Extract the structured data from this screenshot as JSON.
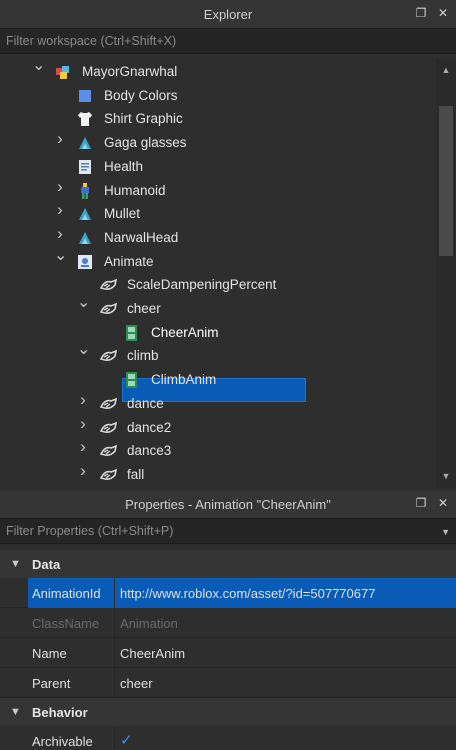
{
  "explorer": {
    "title": "Explorer",
    "filter_placeholder": "Filter workspace (Ctrl+Shift+X)",
    "items": [
      {
        "label": "MayorGnarwhal",
        "icon": "model-icon",
        "expander": "expanded",
        "indent": 0
      },
      {
        "label": "Body Colors",
        "icon": "body-colors-icon",
        "expander": "none",
        "indent": 1
      },
      {
        "label": "Shirt Graphic",
        "icon": "shirt-icon",
        "expander": "none",
        "indent": 1
      },
      {
        "label": "Gaga glasses",
        "icon": "accessory-icon",
        "expander": "collapsed",
        "indent": 1
      },
      {
        "label": "Health",
        "icon": "script-icon",
        "expander": "none",
        "indent": 1
      },
      {
        "label": "Humanoid",
        "icon": "humanoid-icon",
        "expander": "collapsed",
        "indent": 1
      },
      {
        "label": "Mullet",
        "icon": "accessory-icon",
        "expander": "collapsed",
        "indent": 1
      },
      {
        "label": "NarwalHead",
        "icon": "accessory-icon",
        "expander": "collapsed",
        "indent": 1
      },
      {
        "label": "Animate",
        "icon": "local-script-icon",
        "expander": "expanded",
        "indent": 1
      },
      {
        "label": "ScaleDampeningPercent",
        "icon": "value-icon",
        "expander": "none",
        "indent": 2
      },
      {
        "label": "cheer",
        "icon": "value-icon",
        "expander": "expanded",
        "indent": 2
      },
      {
        "label": "CheerAnim",
        "icon": "animation-icon",
        "expander": "none",
        "indent": 3,
        "selected": true
      },
      {
        "label": "climb",
        "icon": "value-icon",
        "expander": "expanded",
        "indent": 2
      },
      {
        "label": "ClimbAnim",
        "icon": "animation-icon",
        "expander": "none",
        "indent": 3
      },
      {
        "label": "dance",
        "icon": "value-icon",
        "expander": "collapsed",
        "indent": 2
      },
      {
        "label": "dance2",
        "icon": "value-icon",
        "expander": "collapsed",
        "indent": 2
      },
      {
        "label": "dance3",
        "icon": "value-icon",
        "expander": "collapsed",
        "indent": 2
      },
      {
        "label": "fall",
        "icon": "value-icon",
        "expander": "collapsed",
        "indent": 2
      }
    ]
  },
  "properties": {
    "title": "Properties - Animation \"CheerAnim\"",
    "filter_placeholder": "Filter Properties (Ctrl+Shift+P)",
    "sections": [
      {
        "label": "Data",
        "rows": [
          {
            "name": "AnimationId",
            "value": "http://www.roblox.com/asset/?id=507770677",
            "selected": true
          },
          {
            "name": "ClassName",
            "value": "Animation",
            "disabled": true
          },
          {
            "name": "Name",
            "value": "CheerAnim"
          },
          {
            "name": "Parent",
            "value": "cheer"
          }
        ]
      },
      {
        "label": "Behavior",
        "rows": [
          {
            "name": "Archivable",
            "value": "checked",
            "type": "checkbox"
          }
        ]
      }
    ]
  },
  "colors": {
    "selection": "#0a5bb5",
    "panel_bg": "#2e2e2e",
    "header_bg": "#353535"
  }
}
